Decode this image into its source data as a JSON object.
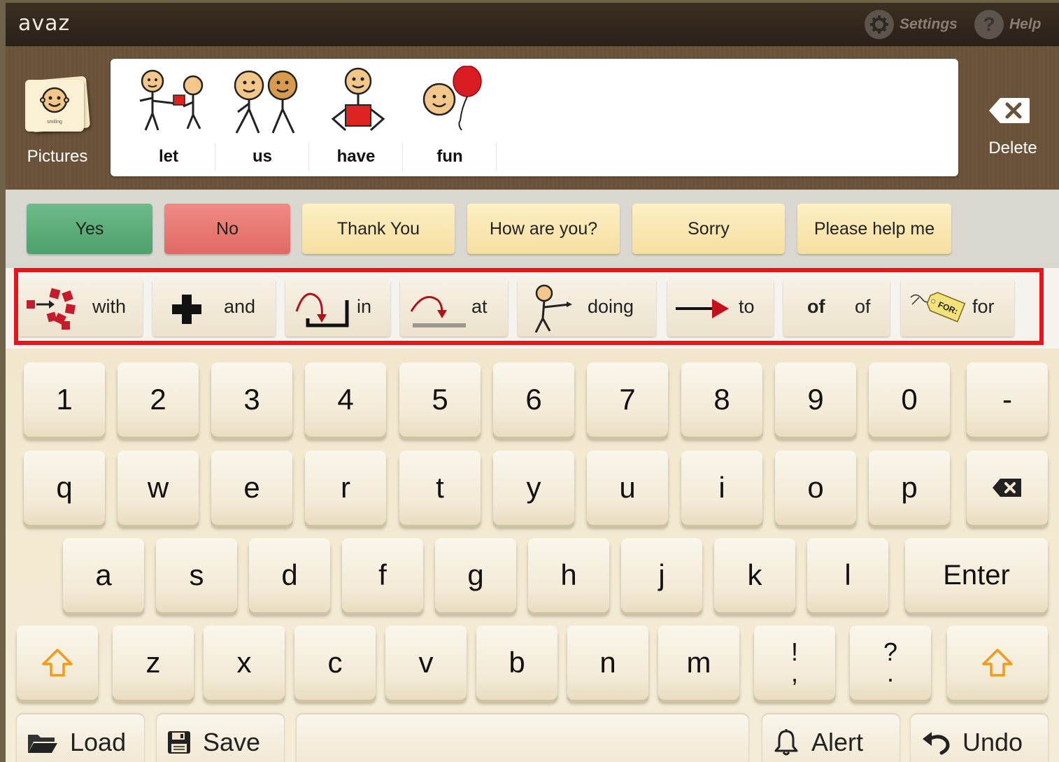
{
  "app": {
    "logo": "avaz"
  },
  "topbar": {
    "settings_label": "Settings",
    "help_label": "Help"
  },
  "pictures": {
    "label": "Pictures",
    "card_caption": "smiling"
  },
  "message": {
    "words": [
      "let",
      "us",
      "have",
      "fun"
    ]
  },
  "delete": {
    "label": "Delete"
  },
  "phrases": [
    "Yes",
    "No",
    "Thank You",
    "How are you?",
    "Sorry",
    "Please help me"
  ],
  "core_words": [
    {
      "label": "with",
      "icon": "with-icon"
    },
    {
      "label": "and",
      "icon": "plus-icon"
    },
    {
      "label": "in",
      "icon": "in-icon"
    },
    {
      "label": "at",
      "icon": "at-icon"
    },
    {
      "label": "doing",
      "icon": "doing-icon"
    },
    {
      "label": "to",
      "icon": "arrow-right-icon"
    },
    {
      "label": "of",
      "icon_text": "of"
    },
    {
      "label": "for",
      "icon": "for-tag-icon",
      "tag_text": "FOR:"
    }
  ],
  "keyboard": {
    "row1": [
      "1",
      "2",
      "3",
      "4",
      "5",
      "6",
      "7",
      "8",
      "9",
      "0",
      "-"
    ],
    "row2": [
      "q",
      "w",
      "e",
      "r",
      "t",
      "y",
      "u",
      "i",
      "o",
      "p"
    ],
    "row3": [
      "a",
      "s",
      "d",
      "f",
      "g",
      "h",
      "j",
      "k",
      "l"
    ],
    "enter_label": "Enter",
    "row4": [
      "z",
      "x",
      "c",
      "v",
      "b",
      "n",
      "m"
    ],
    "punct1": [
      "!",
      ","
    ],
    "punct2": [
      "?",
      "."
    ]
  },
  "bottom": {
    "load_label": "Load",
    "save_label": "Save",
    "alert_label": "Alert",
    "undo_label": "Undo"
  },
  "colors": {
    "highlight": "#e8141b",
    "yes": "#5aae78",
    "no": "#e87872",
    "phrase": "#f8e5ad",
    "shift": "#f29a1a"
  }
}
